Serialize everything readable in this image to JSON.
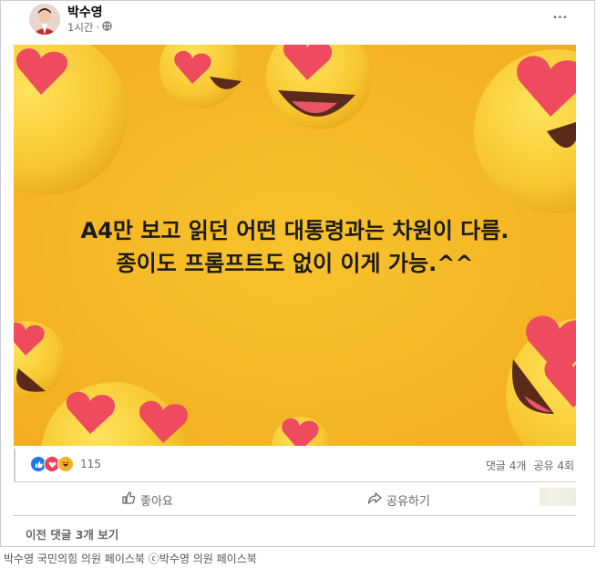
{
  "post": {
    "author": "박수영",
    "time": "1시간",
    "privacy_icon": "globe-icon",
    "more_label": "···",
    "caption_line1": "A4만 보고 읽던 어떤 대통령과는 차원이 다름.",
    "caption_line2": "종이도 프롬프트도 없이 이게 가능.^^"
  },
  "stats": {
    "reaction_count": "115",
    "comments": "댓글 4개",
    "shares": "공유 4회"
  },
  "actions": {
    "like": "좋아요",
    "share": "공유하기"
  },
  "comments": {
    "previous_label": "이전 댓글 3개 보기"
  },
  "footer": {
    "credit": "박수영 국민의힘 의원 페이스북 ⓒ박수영 의원 페이스북"
  },
  "colors": {
    "background": "#f5b625",
    "like_blue": "#1877f2",
    "love_red": "#f33e58"
  }
}
